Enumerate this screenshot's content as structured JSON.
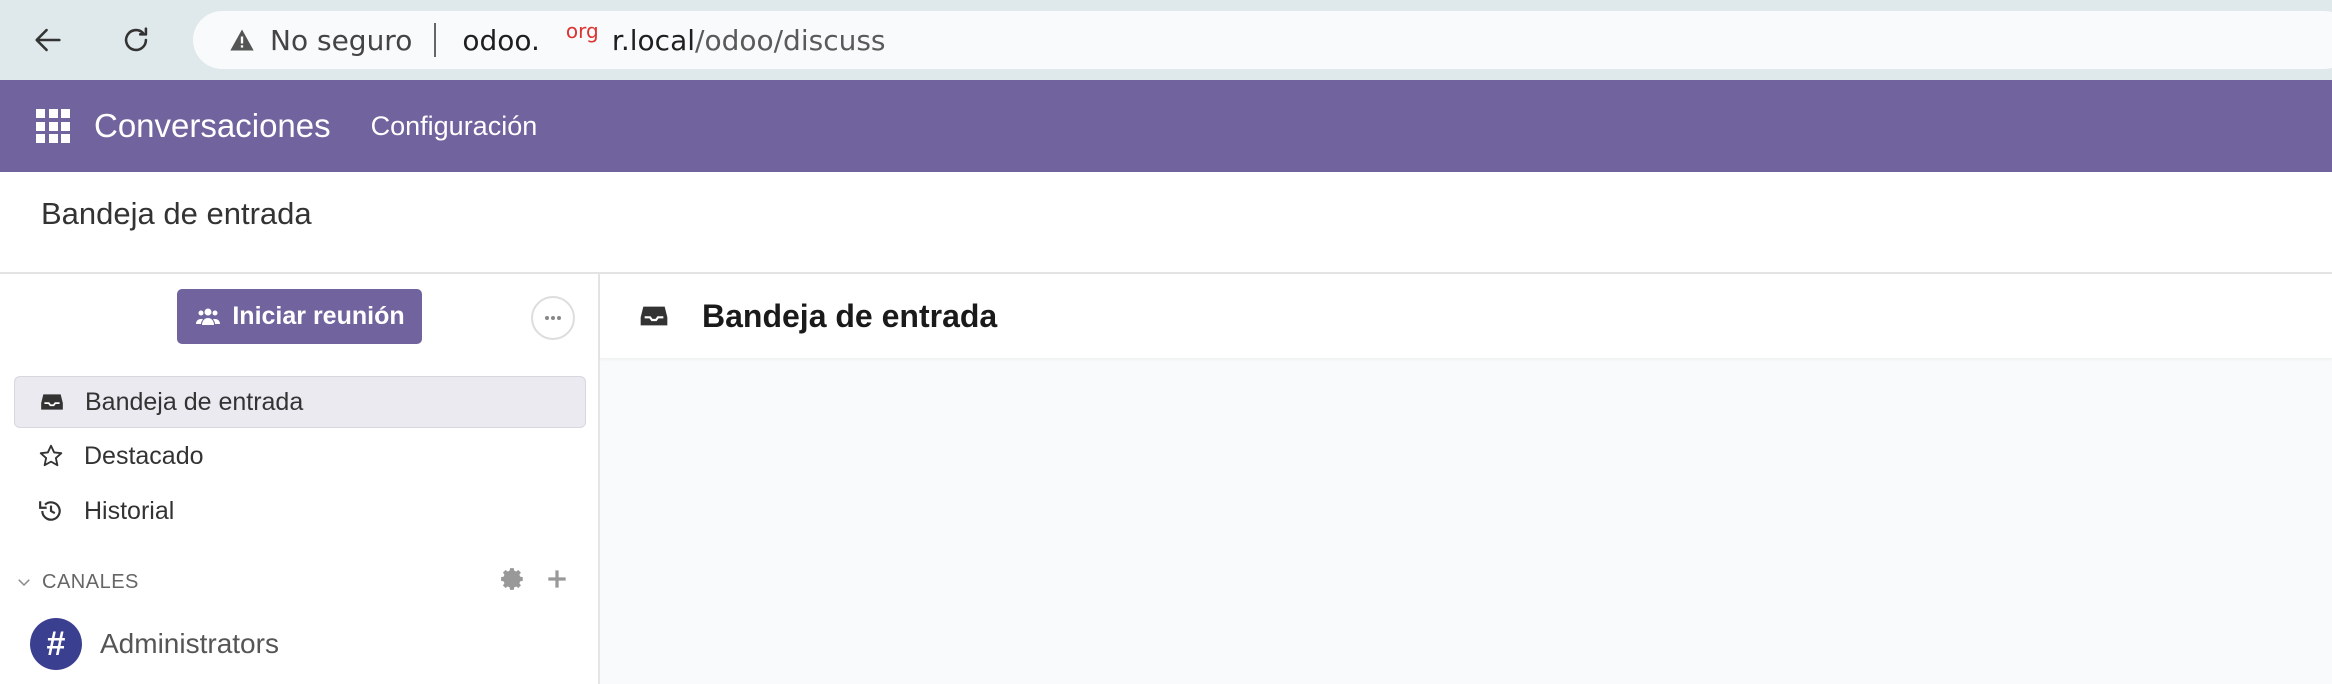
{
  "browser": {
    "security_text": "No seguro",
    "url_host_start": "odoo.",
    "url_host_hidden": "org",
    "url_host_end": "r.local",
    "url_path": "/odoo/discuss"
  },
  "navbar": {
    "app_title": "Conversaciones",
    "menu_config": "Configuración",
    "color": "#71639e"
  },
  "control_panel": {
    "breadcrumb": "Bandeja de entrada"
  },
  "sidebar": {
    "start_meeting_label": "Iniciar reunión",
    "items": [
      {
        "label": "Bandeja de entrada",
        "icon": "inbox-icon",
        "active": true
      },
      {
        "label": "Destacado",
        "icon": "star-icon",
        "active": false
      },
      {
        "label": "Historial",
        "icon": "history-icon",
        "active": false
      }
    ],
    "channels_label": "CANALES",
    "channels": [
      {
        "name": "Administrators",
        "icon": "hashtag-icon"
      }
    ]
  },
  "thread": {
    "title": "Bandeja de entrada",
    "icon": "inbox-icon"
  }
}
